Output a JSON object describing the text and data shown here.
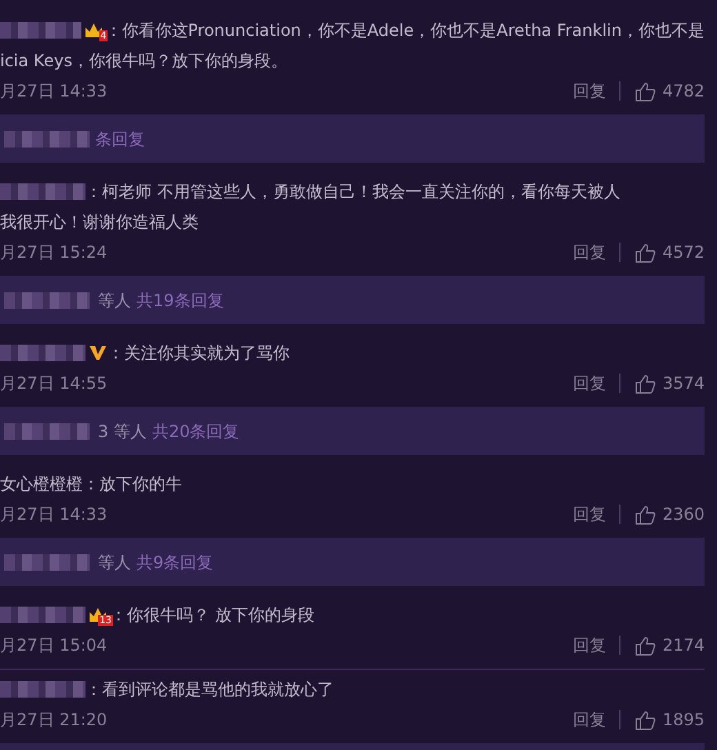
{
  "items": [
    {
      "kind": "comment",
      "user_blurred": true,
      "badge": {
        "kind": "crown",
        "text": "4"
      },
      "lines": [
        "：你看你这Pronunciation，你不是Adele，你也不是Aretha Franklin，你也不是",
        "icia Keys，你很牛吗？放下你的身段。"
      ],
      "date": "月27日 14:33",
      "reply": "回复",
      "likes": "4782"
    },
    {
      "kind": "replies",
      "total": "条回复"
    },
    {
      "kind": "comment",
      "user_blurred": true,
      "lines": [
        "：柯老师 不用管这些人，勇敢做自己！我会一直关注你的，看你每天被人",
        "我很开心！谢谢你造福人类"
      ],
      "date": "月27日 15:24",
      "reply": "回复",
      "likes": "4572"
    },
    {
      "kind": "replies",
      "people": "等人",
      "total": "共19条回复"
    },
    {
      "kind": "comment",
      "user_blurred": true,
      "badge": {
        "kind": "v"
      },
      "lines": [
        "：关注你其实就为了骂你"
      ],
      "date": "月27日 14:55",
      "reply": "回复",
      "likes": "3574"
    },
    {
      "kind": "replies",
      "people": "3 等人",
      "total": "共20条回复"
    },
    {
      "kind": "comment",
      "user": "女心橙橙橙",
      "lines": [
        "：放下你的牛"
      ],
      "date": "月27日 14:33",
      "reply": "回复",
      "likes": "2360"
    },
    {
      "kind": "replies",
      "people": "等人",
      "total": "共9条回复"
    },
    {
      "kind": "comment",
      "user_blurred": true,
      "badge": {
        "kind": "crown",
        "text": "13"
      },
      "lines": [
        "：你很牛吗？ 放下你的身段"
      ],
      "date": "月27日 15:04",
      "reply": "回复",
      "likes": "2174",
      "divider": true
    },
    {
      "kind": "comment",
      "user_blurred": true,
      "lines": [
        "：看到评论都是骂他的我就放心了"
      ],
      "date": "月27日 21:20",
      "reply": "回复",
      "likes": "1895"
    },
    {
      "kind": "replies"
    }
  ]
}
